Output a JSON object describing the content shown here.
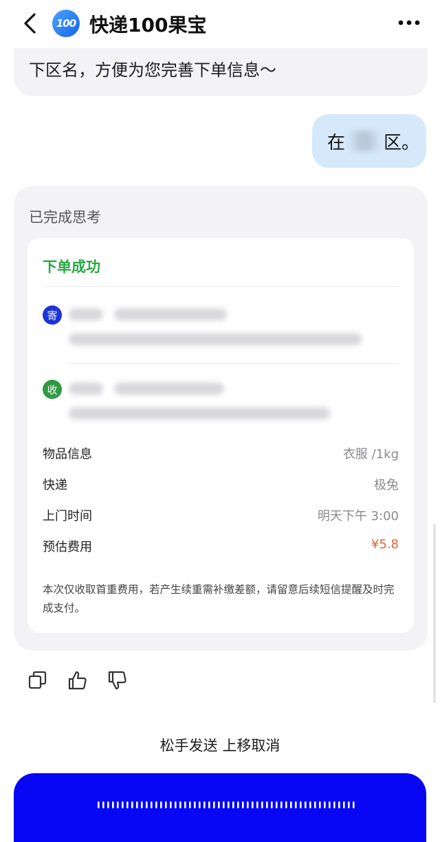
{
  "header": {
    "title": "快递100果宝",
    "logo_text": "100",
    "back_icon": "chevron-left-icon",
    "more_icon": "more-dots-icon"
  },
  "chat": {
    "prev_ai_message_tail": "下区名，方便为您完善下单信息～",
    "user_message_prefix": "在",
    "user_message_suffix": "区。"
  },
  "answer": {
    "thinking_label": "已完成思考",
    "order": {
      "status": "下单成功",
      "sender_badge": "寄",
      "receiver_badge": "收",
      "rows": [
        {
          "label": "物品信息",
          "value": "衣服 /1kg"
        },
        {
          "label": "快递",
          "value": "极兔"
        },
        {
          "label": "上门时间",
          "value": "明天下午 3:00"
        },
        {
          "label": "预估费用",
          "value": "¥5.8"
        }
      ],
      "note": "本次仅收取首重费用，若产生续重需补缴差额，请留意后续短信提醒及时完成支付。"
    },
    "actions": [
      "copy-icon",
      "thumbs-up-icon",
      "thumbs-down-icon"
    ]
  },
  "voice": {
    "hint": "松手发送 上移取消"
  },
  "colors": {
    "accent_green": "#27a844",
    "price": "#e0643a",
    "voice_button": "#0707f5",
    "user_bubble": "#d6e9fb"
  }
}
